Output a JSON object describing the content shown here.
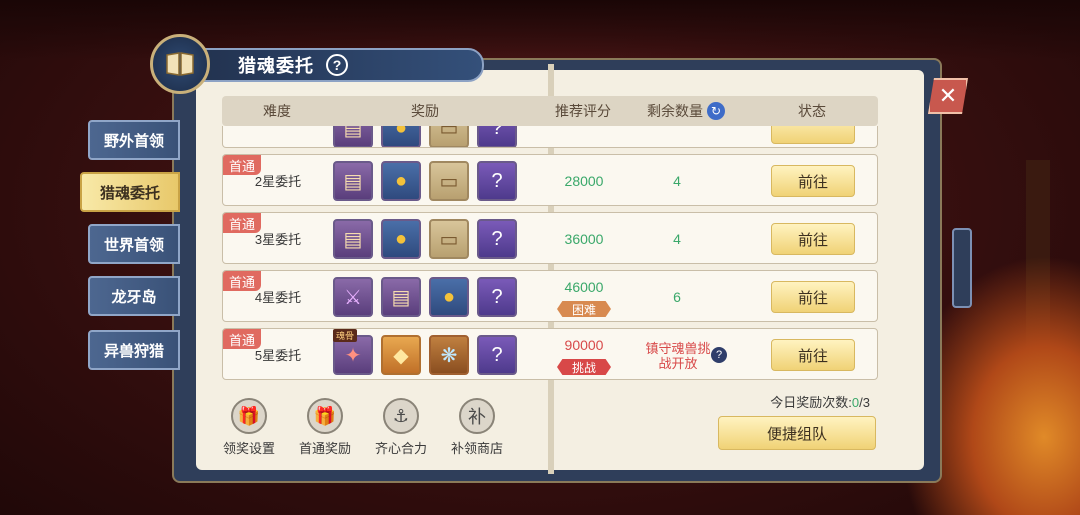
{
  "header": {
    "title": "猎魂委托",
    "help_label": "?"
  },
  "tabs": [
    {
      "label": "野外首领"
    },
    {
      "label": "猎魂委托"
    },
    {
      "label": "世界首领"
    },
    {
      "label": "龙牙岛"
    },
    {
      "label": "异兽狩猎"
    }
  ],
  "table": {
    "headers": {
      "difficulty": "难度",
      "rewards": "奖励",
      "score": "推荐评分",
      "remaining": "剩余数量",
      "status": "状态"
    },
    "rows": [
      {
        "badge": "首通",
        "difficulty": "2星委托",
        "score": "28000",
        "remaining": "4",
        "action": "前往"
      },
      {
        "badge": "首通",
        "difficulty": "3星委托",
        "score": "36000",
        "remaining": "4",
        "action": "前往"
      },
      {
        "badge": "首通",
        "difficulty": "4星委托",
        "score": "46000",
        "tag": "困难",
        "remaining": "6",
        "action": "前往"
      },
      {
        "badge": "首通",
        "difficulty": "5星委托",
        "score": "90000",
        "tag": "挑战",
        "lock_note": "镇守魂兽挑战开放",
        "action": "前往",
        "item_tag": "魂骨"
      }
    ]
  },
  "footer": {
    "buttons": [
      {
        "label": "领奖设置",
        "icon": "gift-icon"
      },
      {
        "label": "首通奖励",
        "icon": "gift-icon"
      },
      {
        "label": "齐心合力",
        "icon": "anchor-icon"
      },
      {
        "label": "补领商店",
        "icon": "补"
      }
    ],
    "daily_label": "今日奖励次数:",
    "daily_current": "0",
    "daily_total": "/3",
    "team_label": "便捷组队"
  },
  "colors": {
    "accent_green": "#3aa86a",
    "accent_red": "#d84a4a",
    "button_gold": "#f0d276",
    "frame_blue": "#2f3e5a"
  }
}
